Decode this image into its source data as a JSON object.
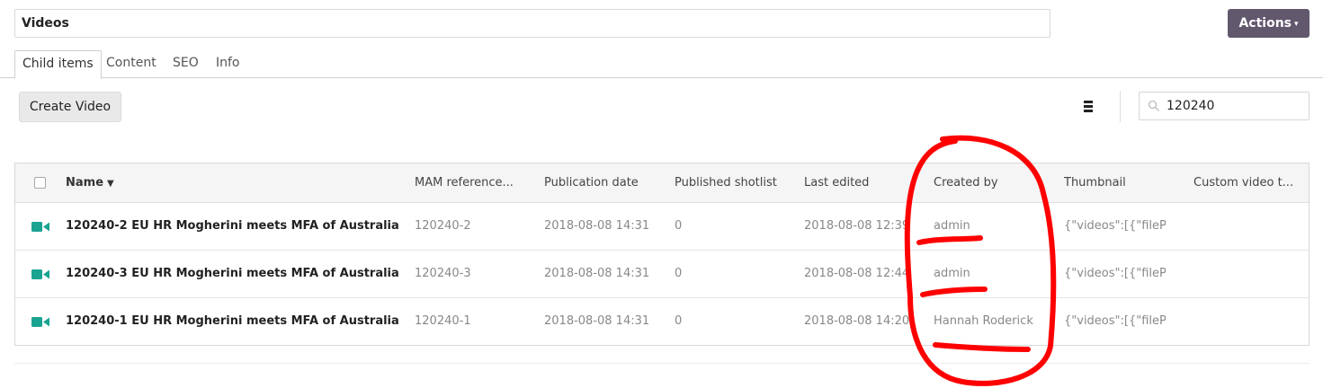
{
  "header": {
    "title_value": "Videos",
    "actions_label": "Actions",
    "actions_caret": "▾"
  },
  "tabs": [
    {
      "label": "Child items",
      "active": true
    },
    {
      "label": "Content",
      "active": false
    },
    {
      "label": "SEO",
      "active": false
    },
    {
      "label": "Info",
      "active": false
    }
  ],
  "toolbar": {
    "create_label": "Create Video",
    "search_value": "120240"
  },
  "table": {
    "columns": [
      "Name",
      "MAM reference...",
      "Publication date",
      "Published shotlist",
      "Last edited",
      "Created by",
      "Thumbnail",
      "Custom video t..."
    ],
    "sort_indicator": "▼",
    "rows": [
      [
        "120240-2 EU HR Mogherini meets MFA of Australia: pr...",
        "120240-2",
        "2018-08-08 14:31",
        "0",
        "2018-08-08 12:39",
        "admin",
        "{\"videos\":[{\"filePatl",
        ""
      ],
      [
        "120240-3 EU HR Mogherini meets MFA of Australia: pr...",
        "120240-3",
        "2018-08-08 14:31",
        "0",
        "2018-08-08 12:44",
        "admin",
        "{\"videos\":[{\"filePatl",
        ""
      ],
      [
        "120240-1 EU HR Mogherini meets MFA of Australia: pr...",
        "120240-1",
        "2018-08-08 14:31",
        "0",
        "2018-08-08 14:20",
        "Hannah Roderick",
        "{\"videos\":[{\"filePatl",
        ""
      ]
    ]
  },
  "colors": {
    "actions_bg": "#62586e",
    "video_icon": "#1aa391",
    "annotation": "#ff0000"
  },
  "icons": [
    "menu-icon",
    "search-icon",
    "video-icon",
    "sort-desc-icon"
  ]
}
